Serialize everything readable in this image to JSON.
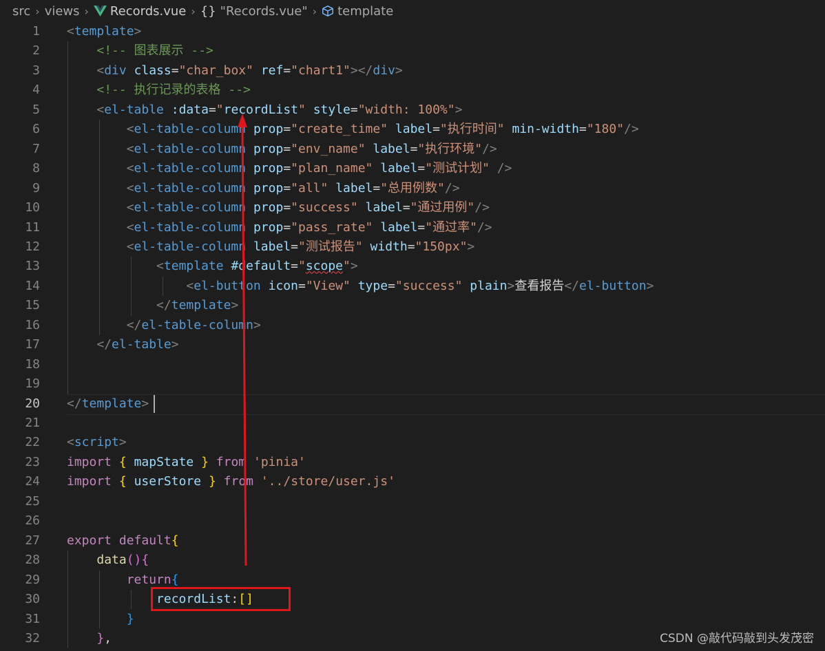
{
  "breadcrumb": {
    "items": [
      "src",
      "views",
      "Records.vue",
      "{}",
      "\"Records.vue\"",
      "template"
    ]
  },
  "editor": {
    "active_line": 20,
    "lines": [
      {
        "n": "1",
        "tokens": [
          [
            "t-punc",
            "<"
          ],
          [
            "t-tag",
            "template"
          ],
          [
            "t-punc",
            ">"
          ]
        ]
      },
      {
        "n": "2",
        "tokens": [
          [
            "t-plain",
            "    "
          ],
          [
            "t-com",
            "<!-- 图表展示 -->"
          ]
        ]
      },
      {
        "n": "3",
        "tokens": [
          [
            "t-plain",
            "    "
          ],
          [
            "t-punc",
            "<"
          ],
          [
            "t-tag",
            "div"
          ],
          [
            "t-plain",
            " "
          ],
          [
            "t-attr",
            "class"
          ],
          [
            "t-plain",
            "="
          ],
          [
            "t-str",
            "\"char_box\""
          ],
          [
            "t-plain",
            " "
          ],
          [
            "t-attr",
            "ref"
          ],
          [
            "t-plain",
            "="
          ],
          [
            "t-str",
            "\"chart1\""
          ],
          [
            "t-punc",
            "></"
          ],
          [
            "t-tag",
            "div"
          ],
          [
            "t-punc",
            ">"
          ]
        ]
      },
      {
        "n": "4",
        "tokens": [
          [
            "t-plain",
            "    "
          ],
          [
            "t-com",
            "<!-- 执行记录的表格 -->"
          ]
        ]
      },
      {
        "n": "5",
        "tokens": [
          [
            "t-plain",
            "    "
          ],
          [
            "t-punc",
            "<"
          ],
          [
            "t-tag",
            "el-table"
          ],
          [
            "t-plain",
            " "
          ],
          [
            "t-attr",
            ":data"
          ],
          [
            "t-plain",
            "="
          ],
          [
            "t-str",
            "\""
          ],
          [
            "t-attr",
            "recordList"
          ],
          [
            "t-str",
            "\""
          ],
          [
            "t-plain",
            " "
          ],
          [
            "t-attr",
            "style"
          ],
          [
            "t-plain",
            "="
          ],
          [
            "t-str",
            "\"width: 100%\""
          ],
          [
            "t-punc",
            ">"
          ]
        ]
      },
      {
        "n": "6",
        "tokens": [
          [
            "t-plain",
            "        "
          ],
          [
            "t-punc",
            "<"
          ],
          [
            "t-tag",
            "el-table-column"
          ],
          [
            "t-plain",
            " "
          ],
          [
            "t-attr",
            "prop"
          ],
          [
            "t-plain",
            "="
          ],
          [
            "t-str",
            "\"create_time\""
          ],
          [
            "t-plain",
            " "
          ],
          [
            "t-attr",
            "label"
          ],
          [
            "t-plain",
            "="
          ],
          [
            "t-str",
            "\"执行时间\""
          ],
          [
            "t-plain",
            " "
          ],
          [
            "t-attr",
            "min-width"
          ],
          [
            "t-plain",
            "="
          ],
          [
            "t-str",
            "\"180\""
          ],
          [
            "t-punc",
            "/>"
          ]
        ]
      },
      {
        "n": "7",
        "tokens": [
          [
            "t-plain",
            "        "
          ],
          [
            "t-punc",
            "<"
          ],
          [
            "t-tag",
            "el-table-column"
          ],
          [
            "t-plain",
            " "
          ],
          [
            "t-attr",
            "prop"
          ],
          [
            "t-plain",
            "="
          ],
          [
            "t-str",
            "\"env_name\""
          ],
          [
            "t-plain",
            " "
          ],
          [
            "t-attr",
            "label"
          ],
          [
            "t-plain",
            "="
          ],
          [
            "t-str",
            "\"执行环境\""
          ],
          [
            "t-punc",
            "/>"
          ]
        ]
      },
      {
        "n": "8",
        "tokens": [
          [
            "t-plain",
            "        "
          ],
          [
            "t-punc",
            "<"
          ],
          [
            "t-tag",
            "el-table-column"
          ],
          [
            "t-plain",
            " "
          ],
          [
            "t-attr",
            "prop"
          ],
          [
            "t-plain",
            "="
          ],
          [
            "t-str",
            "\"plan_name\""
          ],
          [
            "t-plain",
            " "
          ],
          [
            "t-attr",
            "label"
          ],
          [
            "t-plain",
            "="
          ],
          [
            "t-str",
            "\"测试计划\""
          ],
          [
            "t-plain",
            " "
          ],
          [
            "t-punc",
            "/>"
          ]
        ]
      },
      {
        "n": "9",
        "tokens": [
          [
            "t-plain",
            "        "
          ],
          [
            "t-punc",
            "<"
          ],
          [
            "t-tag",
            "el-table-column"
          ],
          [
            "t-plain",
            " "
          ],
          [
            "t-attr",
            "prop"
          ],
          [
            "t-plain",
            "="
          ],
          [
            "t-str",
            "\"all\""
          ],
          [
            "t-plain",
            " "
          ],
          [
            "t-attr",
            "label"
          ],
          [
            "t-plain",
            "="
          ],
          [
            "t-str",
            "\"总用例数\""
          ],
          [
            "t-punc",
            "/>"
          ]
        ]
      },
      {
        "n": "10",
        "tokens": [
          [
            "t-plain",
            "        "
          ],
          [
            "t-punc",
            "<"
          ],
          [
            "t-tag",
            "el-table-column"
          ],
          [
            "t-plain",
            " "
          ],
          [
            "t-attr",
            "prop"
          ],
          [
            "t-plain",
            "="
          ],
          [
            "t-str",
            "\"success\""
          ],
          [
            "t-plain",
            " "
          ],
          [
            "t-attr",
            "label"
          ],
          [
            "t-plain",
            "="
          ],
          [
            "t-str",
            "\"通过用例\""
          ],
          [
            "t-punc",
            "/>"
          ]
        ]
      },
      {
        "n": "11",
        "tokens": [
          [
            "t-plain",
            "        "
          ],
          [
            "t-punc",
            "<"
          ],
          [
            "t-tag",
            "el-table-column"
          ],
          [
            "t-plain",
            " "
          ],
          [
            "t-attr",
            "prop"
          ],
          [
            "t-plain",
            "="
          ],
          [
            "t-str",
            "\"pass_rate\""
          ],
          [
            "t-plain",
            " "
          ],
          [
            "t-attr",
            "label"
          ],
          [
            "t-plain",
            "="
          ],
          [
            "t-str",
            "\"通过率\""
          ],
          [
            "t-punc",
            "/>"
          ]
        ]
      },
      {
        "n": "12",
        "tokens": [
          [
            "t-plain",
            "        "
          ],
          [
            "t-punc",
            "<"
          ],
          [
            "t-tag",
            "el-table-column"
          ],
          [
            "t-plain",
            " "
          ],
          [
            "t-attr",
            "label"
          ],
          [
            "t-plain",
            "="
          ],
          [
            "t-str",
            "\"测试报告\""
          ],
          [
            "t-plain",
            " "
          ],
          [
            "t-attr",
            "width"
          ],
          [
            "t-plain",
            "="
          ],
          [
            "t-str",
            "\"150px\""
          ],
          [
            "t-punc",
            ">"
          ]
        ]
      },
      {
        "n": "13",
        "tokens": [
          [
            "t-plain",
            "            "
          ],
          [
            "t-punc",
            "<"
          ],
          [
            "t-tag",
            "template"
          ],
          [
            "t-plain",
            " "
          ],
          [
            "t-attr",
            "#default"
          ],
          [
            "t-plain",
            "="
          ],
          [
            "t-str",
            "\""
          ],
          [
            "t-attr",
            "scope",
            "squig"
          ],
          [
            "t-str",
            "\""
          ],
          [
            "t-punc",
            ">"
          ]
        ]
      },
      {
        "n": "14",
        "tokens": [
          [
            "t-plain",
            "                "
          ],
          [
            "t-punc",
            "<"
          ],
          [
            "t-tag",
            "el-button"
          ],
          [
            "t-plain",
            " "
          ],
          [
            "t-attr",
            "icon"
          ],
          [
            "t-plain",
            "="
          ],
          [
            "t-str",
            "\"View\""
          ],
          [
            "t-plain",
            " "
          ],
          [
            "t-attr",
            "type"
          ],
          [
            "t-plain",
            "="
          ],
          [
            "t-str",
            "\"success\""
          ],
          [
            "t-plain",
            " "
          ],
          [
            "t-attr",
            "plain"
          ],
          [
            "t-punc",
            ">"
          ],
          [
            "t-plain",
            "查看报告"
          ],
          [
            "t-punc",
            "</"
          ],
          [
            "t-tag",
            "el-button"
          ],
          [
            "t-punc",
            ">"
          ]
        ]
      },
      {
        "n": "15",
        "tokens": [
          [
            "t-plain",
            "            "
          ],
          [
            "t-punc",
            "</"
          ],
          [
            "t-tag",
            "template"
          ],
          [
            "t-punc",
            ">"
          ]
        ]
      },
      {
        "n": "16",
        "tokens": [
          [
            "t-plain",
            "        "
          ],
          [
            "t-punc",
            "</"
          ],
          [
            "t-tag",
            "el-table-column"
          ],
          [
            "t-punc",
            ">"
          ]
        ]
      },
      {
        "n": "17",
        "tokens": [
          [
            "t-plain",
            "    "
          ],
          [
            "t-punc",
            "</"
          ],
          [
            "t-tag",
            "el-table"
          ],
          [
            "t-punc",
            ">"
          ]
        ]
      },
      {
        "n": "18",
        "tokens": []
      },
      {
        "n": "19",
        "tokens": []
      },
      {
        "n": "20",
        "tokens": [
          [
            "t-punc",
            "</"
          ],
          [
            "t-tag",
            "template"
          ],
          [
            "t-punc",
            ">"
          ]
        ]
      },
      {
        "n": "21",
        "tokens": []
      },
      {
        "n": "22",
        "tokens": [
          [
            "t-punc",
            "<"
          ],
          [
            "t-tag",
            "script"
          ],
          [
            "t-punc",
            ">"
          ]
        ]
      },
      {
        "n": "23",
        "tokens": [
          [
            "t-kw",
            "import"
          ],
          [
            "t-plain",
            " "
          ],
          [
            "t-br1",
            "{"
          ],
          [
            "t-plain",
            " "
          ],
          [
            "t-attr",
            "mapState"
          ],
          [
            "t-plain",
            " "
          ],
          [
            "t-br1",
            "}"
          ],
          [
            "t-plain",
            " "
          ],
          [
            "t-kw",
            "from"
          ],
          [
            "t-plain",
            " "
          ],
          [
            "t-str",
            "'pinia'"
          ]
        ]
      },
      {
        "n": "24",
        "tokens": [
          [
            "t-kw",
            "import"
          ],
          [
            "t-plain",
            " "
          ],
          [
            "t-br1",
            "{"
          ],
          [
            "t-plain",
            " "
          ],
          [
            "t-attr",
            "userStore"
          ],
          [
            "t-plain",
            " "
          ],
          [
            "t-br1",
            "}"
          ],
          [
            "t-plain",
            " "
          ],
          [
            "t-kw",
            "from"
          ],
          [
            "t-plain",
            " "
          ],
          [
            "t-str",
            "'../store/user.js'"
          ]
        ]
      },
      {
        "n": "25",
        "tokens": []
      },
      {
        "n": "26",
        "tokens": []
      },
      {
        "n": "27",
        "tokens": [
          [
            "t-kw",
            "export"
          ],
          [
            "t-plain",
            " "
          ],
          [
            "t-kw",
            "default"
          ],
          [
            "t-br1",
            "{"
          ]
        ]
      },
      {
        "n": "28",
        "tokens": [
          [
            "t-plain",
            "    "
          ],
          [
            "t-fn",
            "data"
          ],
          [
            "t-br2",
            "()"
          ],
          [
            "t-br2",
            "{"
          ]
        ]
      },
      {
        "n": "29",
        "tokens": [
          [
            "t-plain",
            "        "
          ],
          [
            "t-kw",
            "return"
          ],
          [
            "t-br3",
            "{"
          ]
        ]
      },
      {
        "n": "30",
        "tokens": [
          [
            "t-plain",
            "            "
          ],
          [
            "t-attr",
            "recordList"
          ],
          [
            "t-plain",
            ":"
          ],
          [
            "t-br1",
            "[]"
          ]
        ]
      },
      {
        "n": "31",
        "tokens": [
          [
            "t-plain",
            "        "
          ],
          [
            "t-br3",
            "}"
          ]
        ]
      },
      {
        "n": "32",
        "tokens": [
          [
            "t-plain",
            "    "
          ],
          [
            "t-br2",
            "}"
          ],
          [
            "t-plain",
            ","
          ]
        ]
      }
    ]
  },
  "annotations": {
    "arrow_color": "#e0161b",
    "box_color": "#e0161b"
  },
  "watermark": "CSDN @敲代码敲到头发茂密"
}
